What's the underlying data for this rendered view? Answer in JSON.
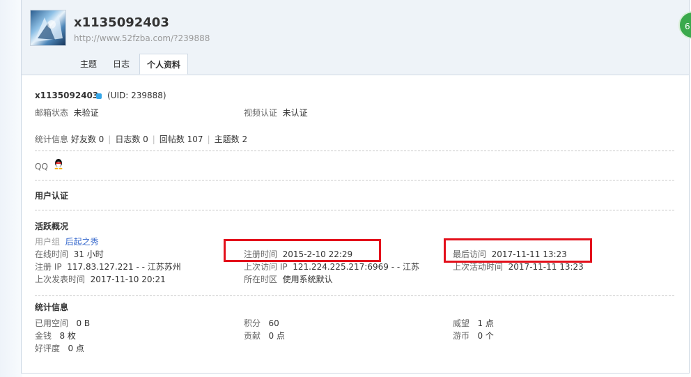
{
  "header": {
    "username": "x1135092403",
    "url": "http://www.52fzba.com/?239888",
    "badge": "6"
  },
  "tabs": [
    {
      "label": "主题"
    },
    {
      "label": "日志"
    },
    {
      "label": "个人资料"
    }
  ],
  "profile": {
    "name": "x1135092403",
    "uid": "(UID: 239888)",
    "email_label": "邮箱状态",
    "email_value": "未验证",
    "video_label": "视频认证",
    "video_value": "未认证",
    "stats_label": "统计信息",
    "stats": [
      "好友数 0",
      "日志数 0",
      "回帖数 107",
      "主题数 2"
    ],
    "qq_label": "QQ"
  },
  "sections": {
    "user_auth": "用户认证",
    "activity": "活跃概况",
    "statistics": "统计信息"
  },
  "activity": {
    "group_label": "用户组",
    "group_value": "后起之秀",
    "online_label": "在线时间",
    "online_value": "31 小时",
    "reg_time_label": "注册时间",
    "reg_time_value": "2015-2-10 22:29",
    "last_visit_label": "最后访问",
    "last_visit_value": "2017-11-11 13:23",
    "reg_ip_label": "注册 IP",
    "reg_ip_value": "117.83.127.221 - - 江苏苏州",
    "last_ip_label": "上次访问 IP",
    "last_ip_value": "121.224.225.217:6969 - - 江苏",
    "last_active_label": "上次活动时间",
    "last_active_value": "2017-11-11 13:23",
    "last_post_label": "上次发表时间",
    "last_post_value": "2017-11-10 20:21",
    "timezone_label": "所在时区",
    "timezone_value": "使用系统默认"
  },
  "statistics": {
    "space_label": "已用空间",
    "space_value": "0 B",
    "points_label": "积分",
    "points_value": "60",
    "prestige_label": "威望",
    "prestige_value": "1 点",
    "money_label": "金钱",
    "money_value": "8 枚",
    "contrib_label": "贡献",
    "contrib_value": "0 点",
    "coin_label": "游币",
    "coin_value": "0 个",
    "rating_label": "好评度",
    "rating_value": "0 点"
  },
  "colors": {
    "highlight_box": "#e3101b",
    "link": "#3366cc",
    "badge": "#3aa94c"
  }
}
